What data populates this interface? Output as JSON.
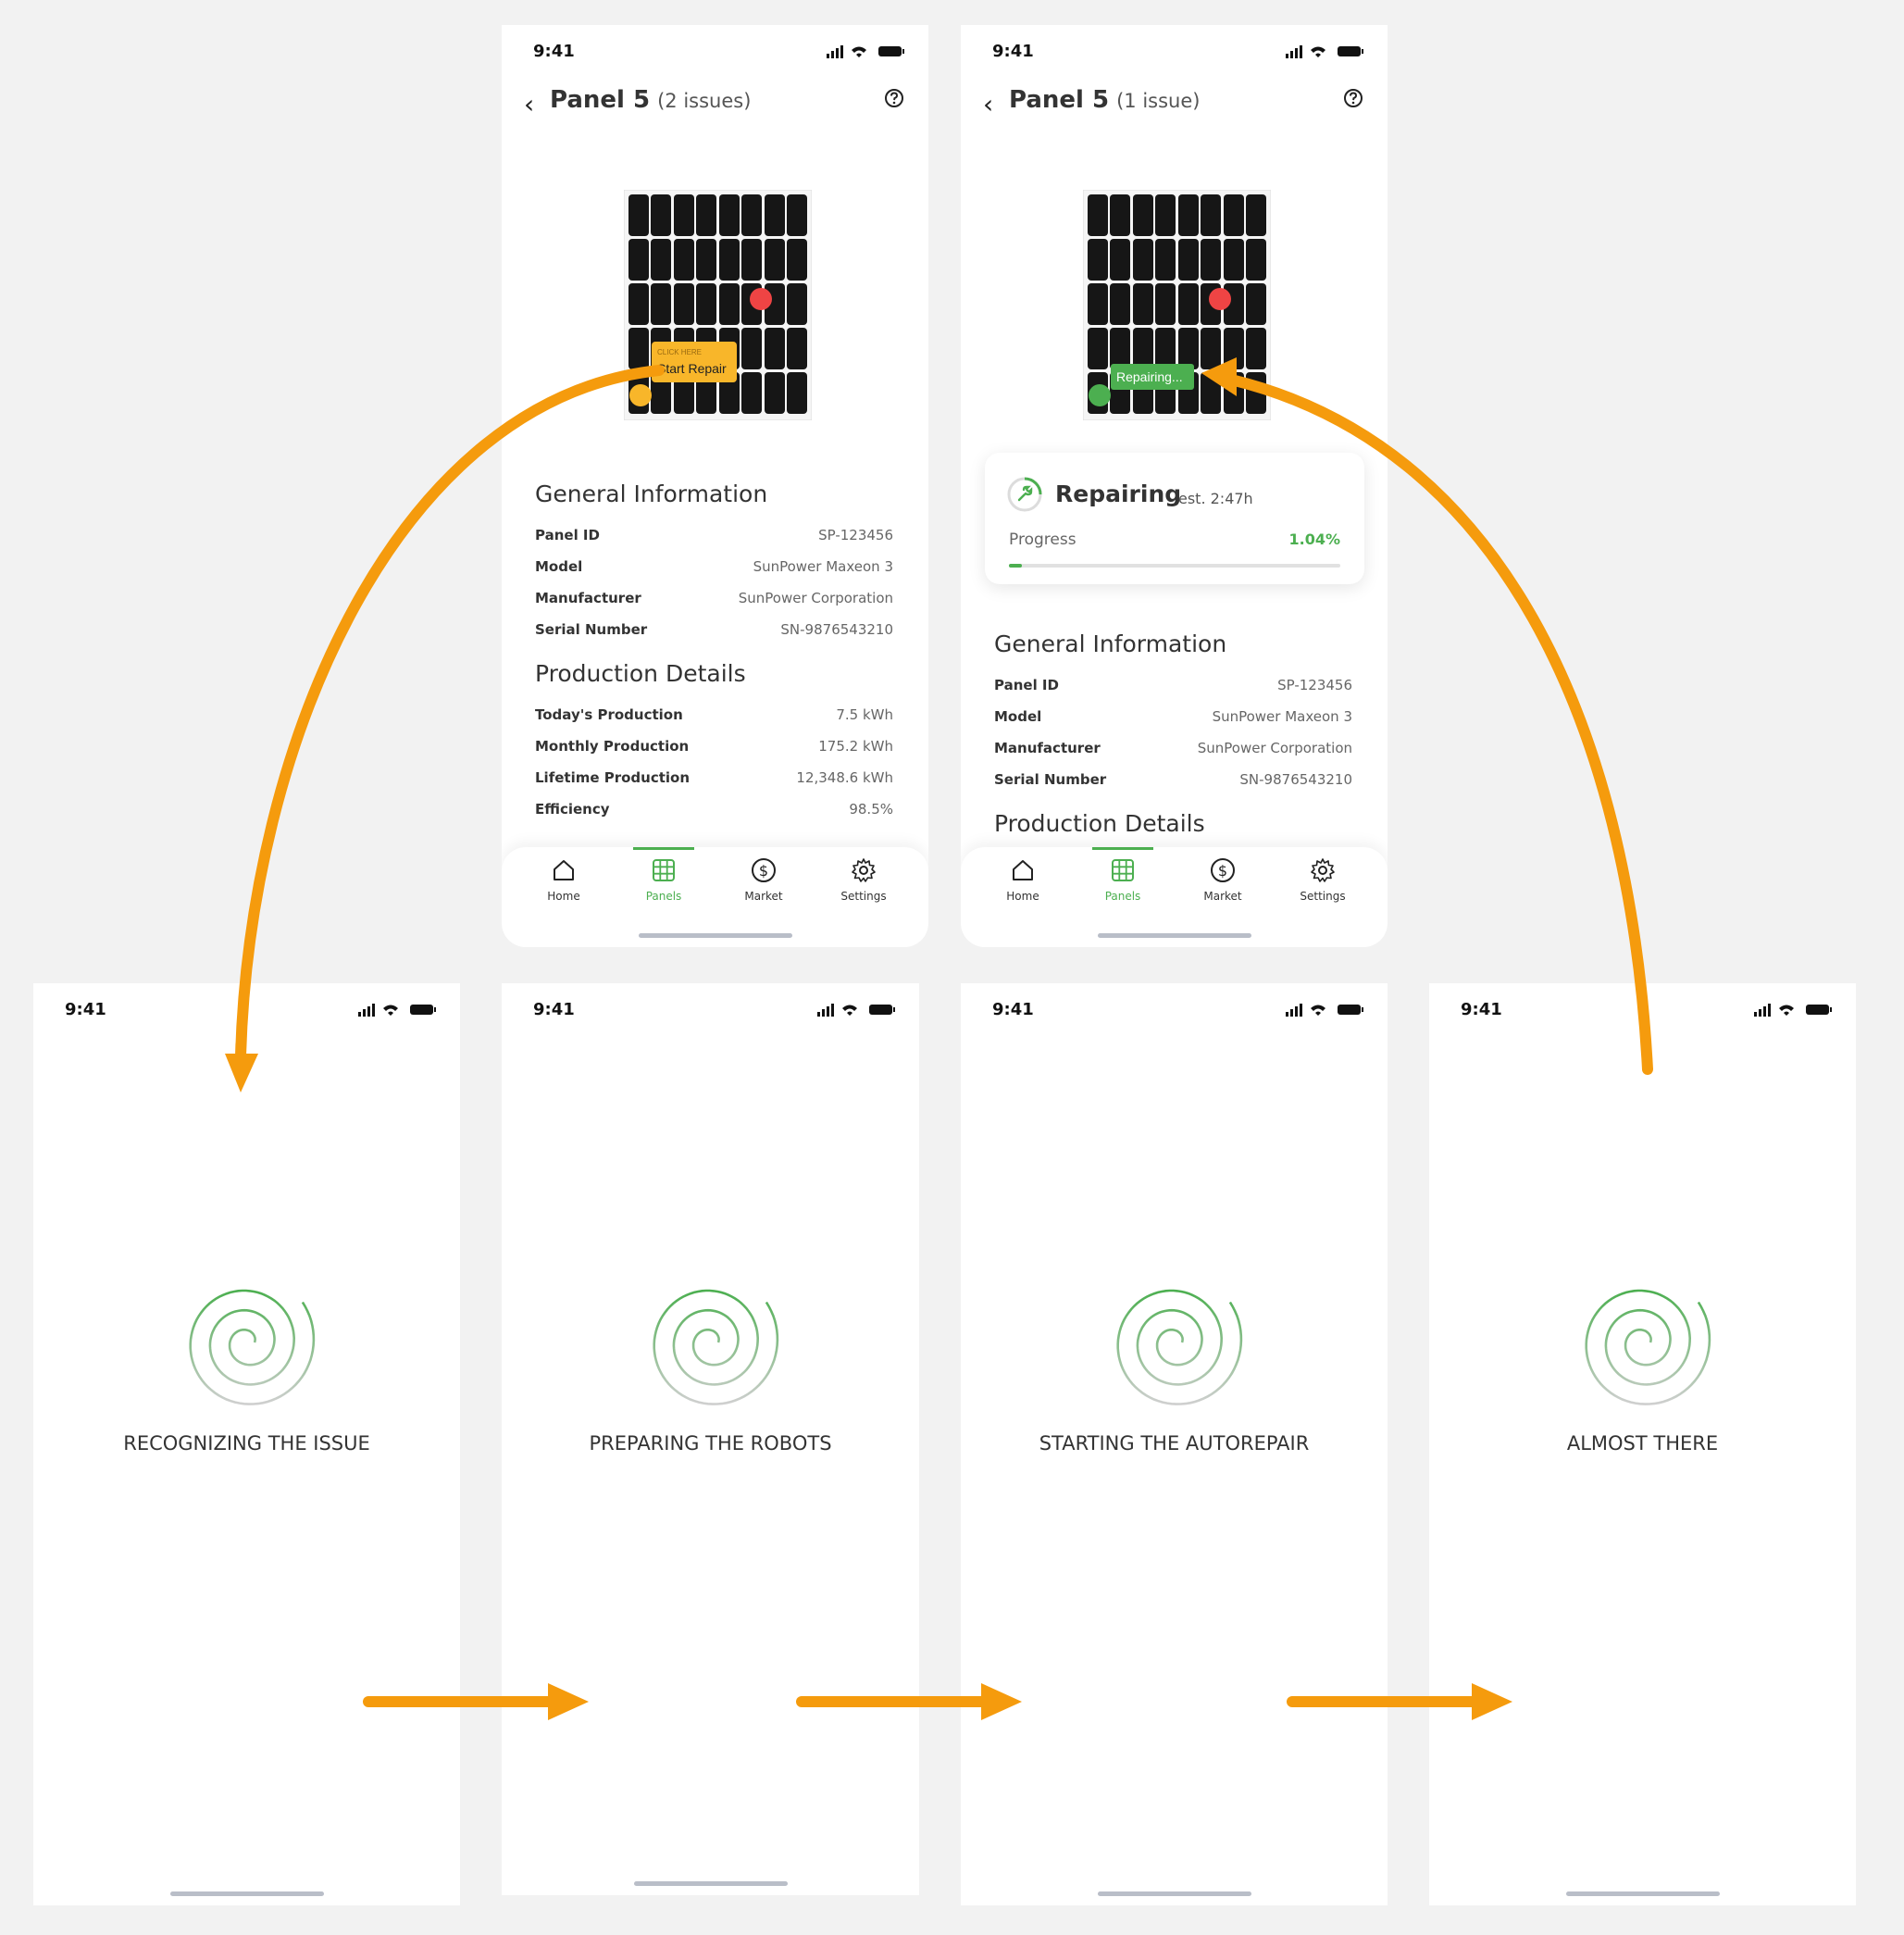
{
  "statusbar": {
    "time": "9:41"
  },
  "detail_before": {
    "title": "Panel 5",
    "issues": "(2 issues)",
    "tooltip_hint": "CLICK HERE",
    "tooltip_action": "Start Repair"
  },
  "detail_after": {
    "title": "Panel 5",
    "issues": "(1 issue)",
    "badge": "Repairing...",
    "repair": {
      "title": "Repairing",
      "estimate": "est. 2:47h",
      "progress_label": "Progress",
      "progress_value": "1.04%",
      "progress_fraction": 0.0104
    }
  },
  "general": {
    "title": "General Information",
    "rows": [
      {
        "label": "Panel ID",
        "value": "SP-123456"
      },
      {
        "label": "Model",
        "value": "SunPower Maxeon 3"
      },
      {
        "label": "Manufacturer",
        "value": "SunPower Corporation"
      },
      {
        "label": "Serial Number",
        "value": "SN-9876543210"
      }
    ]
  },
  "production": {
    "title": "Production Details",
    "rows": [
      {
        "label": "Today's Production",
        "value": "7.5 kWh"
      },
      {
        "label": "Monthly Production",
        "value": "175.2 kWh"
      },
      {
        "label": "Lifetime Production",
        "value": "12,348.6 kWh"
      },
      {
        "label": "Efficiency",
        "value": "98.5%"
      }
    ]
  },
  "tabs": [
    {
      "label": "Home",
      "icon": "home-icon"
    },
    {
      "label": "Panels",
      "icon": "panels-grid-icon",
      "active": true
    },
    {
      "label": "Market",
      "icon": "dollar-icon"
    },
    {
      "label": "Settings",
      "icon": "gear-icon"
    }
  ],
  "loaders": [
    "RECOGNIZING THE ISSUE",
    "PREPARING THE ROBOTS",
    "STARTING THE AUTOREPAIR",
    "ALMOST THERE"
  ],
  "colors": {
    "accent_green": "#4caf50",
    "flow_arrow": "#f59b0d",
    "issue_red": "#ef4444",
    "issue_yellow": "#f8b62a"
  }
}
